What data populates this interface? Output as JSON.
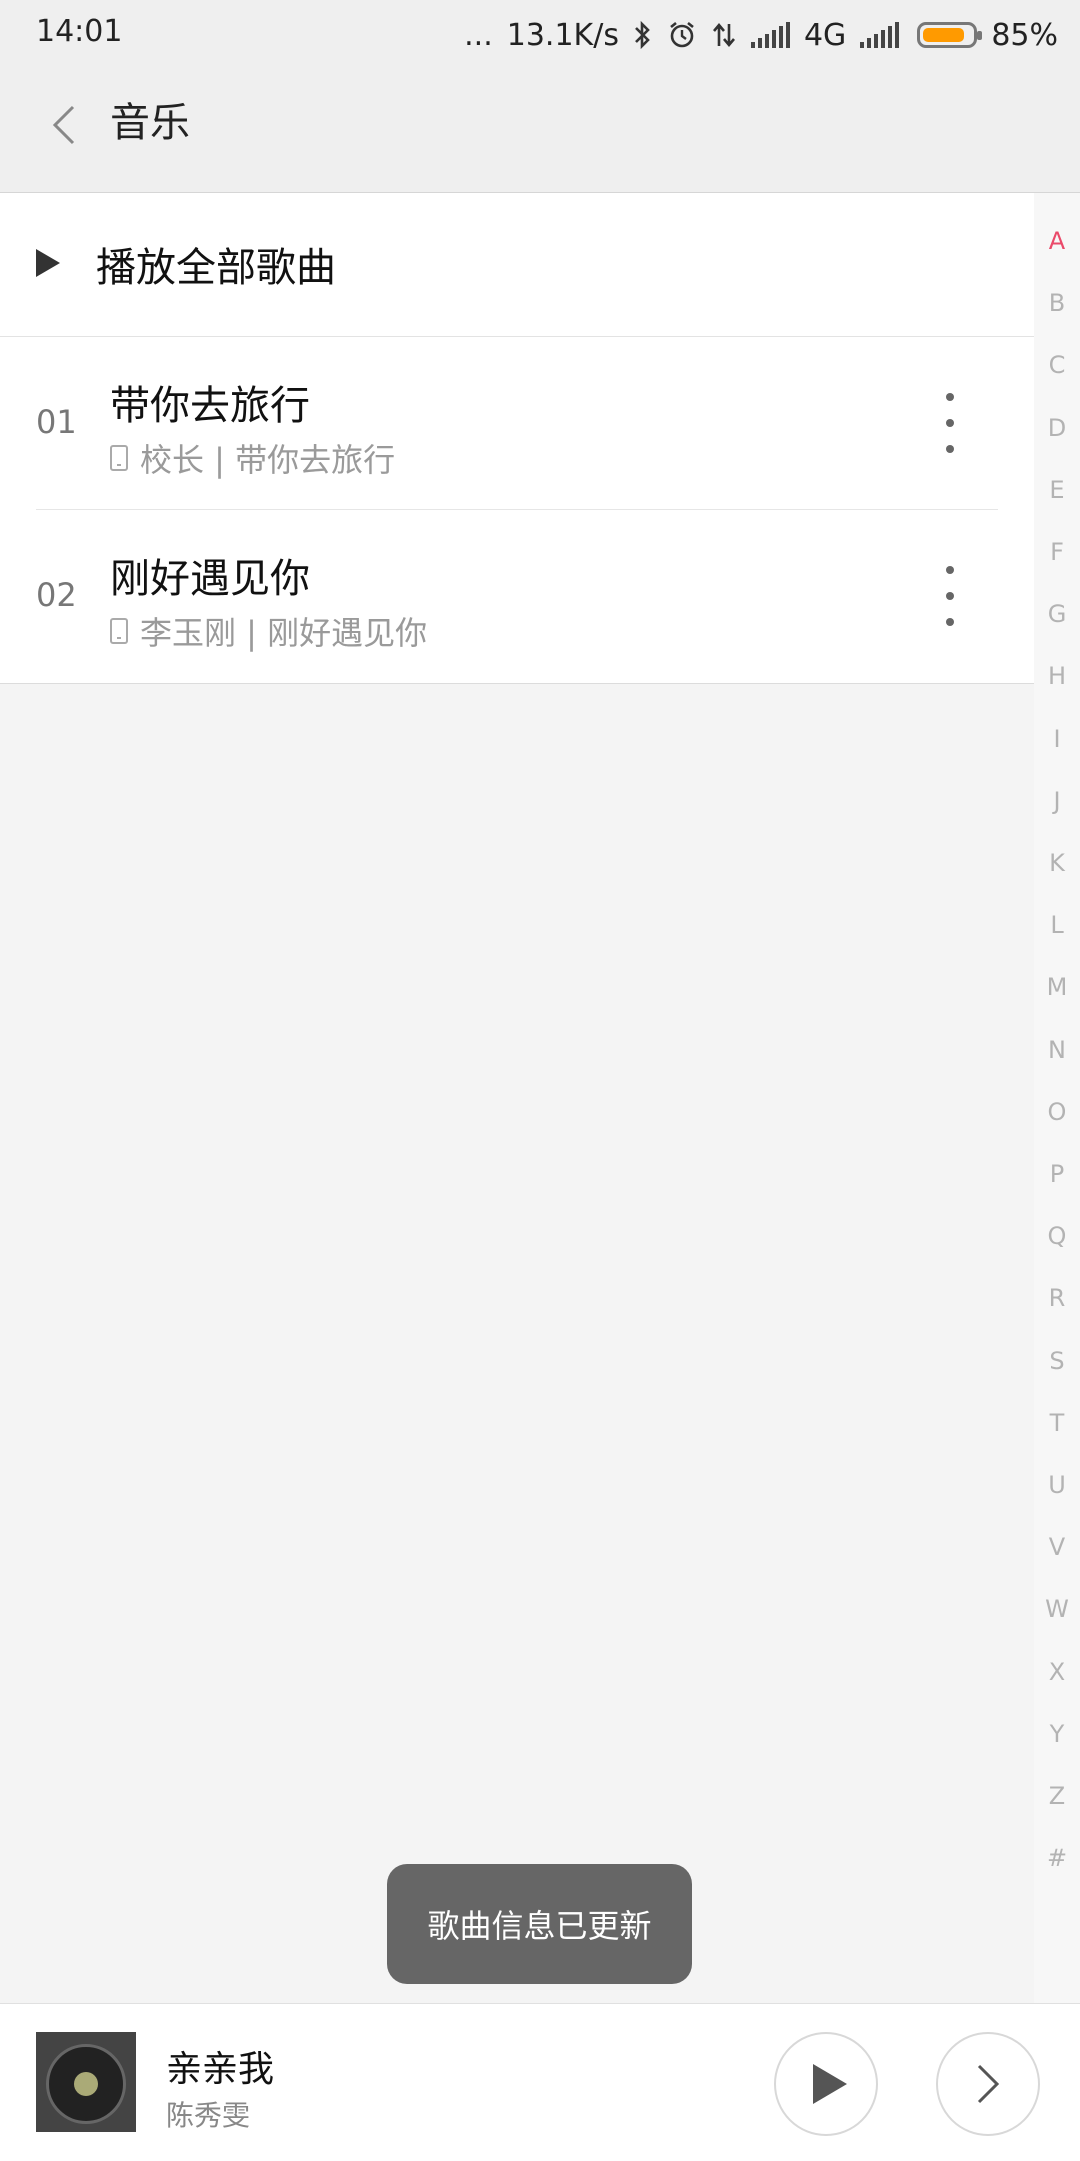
{
  "status_bar": {
    "time": "14:01",
    "dots": "...",
    "speed": "13.1K/s",
    "network": "4G",
    "battery_percent": "85%",
    "battery_level": 0.85,
    "battery_color": "#ff9a00",
    "icons": [
      "bluetooth-icon",
      "alarm-icon",
      "data-transfer-icon",
      "signal-icon",
      "signal-icon-2",
      "battery-icon"
    ]
  },
  "header": {
    "back_icon": "chevron-left-icon",
    "title": "音乐"
  },
  "play_all": {
    "icon": "play-icon",
    "label": "播放全部歌曲"
  },
  "songs": [
    {
      "num": "01",
      "name": "带你去旅行",
      "subtitle": "校长 | 带你去旅行"
    },
    {
      "num": "02",
      "name": "刚好遇见你",
      "subtitle": "李玉刚 | 刚好遇见你"
    }
  ],
  "index": {
    "letters": [
      "A",
      "B",
      "C",
      "D",
      "E",
      "F",
      "G",
      "H",
      "I",
      "J",
      "K",
      "L",
      "M",
      "N",
      "O",
      "P",
      "Q",
      "R",
      "S",
      "T",
      "U",
      "V",
      "W",
      "X",
      "Y",
      "Z",
      "#"
    ],
    "active": "A",
    "active_color": "#ea4a6a"
  },
  "toast": {
    "text": "歌曲信息已更新"
  },
  "player": {
    "title": "亲亲我",
    "artist": "陈秀雯",
    "play_icon": "play-icon",
    "next_icon": "chevron-right-icon"
  }
}
